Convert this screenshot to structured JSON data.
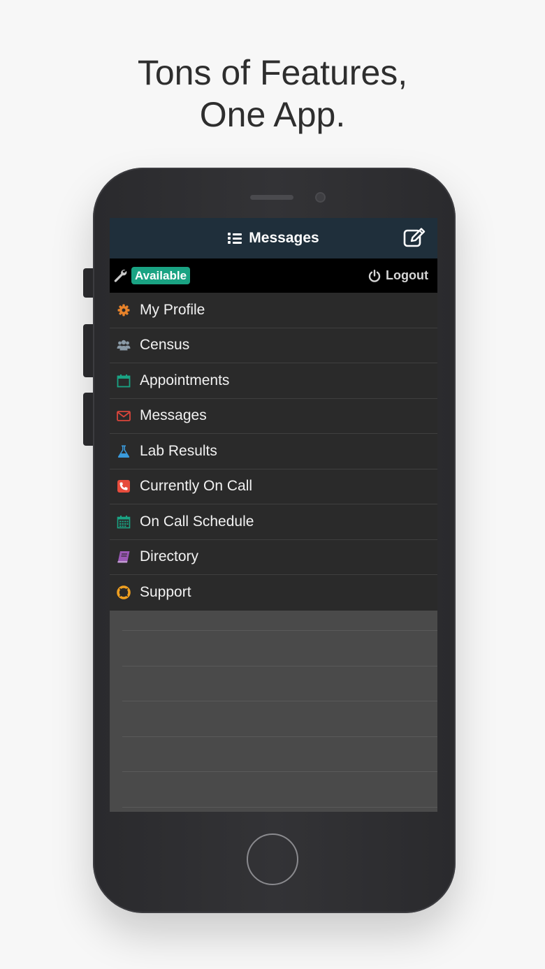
{
  "headline": {
    "line1": "Tons of Features,",
    "line2": "One App."
  },
  "topbar": {
    "title": "Messages",
    "title_icon": "list-icon",
    "action_icon": "compose-icon"
  },
  "status": {
    "tool_icon": "wrench-icon",
    "availability": "Available",
    "logout_label": "Logout",
    "logout_icon": "power-icon"
  },
  "menu": {
    "items": [
      {
        "label": "My Profile",
        "icon": "gear-icon",
        "color": "#e8832a"
      },
      {
        "label": "Census",
        "icon": "users-icon",
        "color": "#8a9aa6"
      },
      {
        "label": "Appointments",
        "icon": "calendar-icon",
        "color": "#1aa383"
      },
      {
        "label": "Messages",
        "icon": "envelope-icon",
        "color": "#d9453b"
      },
      {
        "label": "Lab Results",
        "icon": "flask-icon",
        "color": "#3a9bdc"
      },
      {
        "label": "Currently On Call",
        "icon": "phone-icon",
        "color": "#e74c3c"
      },
      {
        "label": "On Call Schedule",
        "icon": "calendar-grid-icon",
        "color": "#1aa383"
      },
      {
        "label": "Directory",
        "icon": "book-icon",
        "color": "#9b59b6"
      },
      {
        "label": "Support",
        "icon": "lifebuoy-icon",
        "color": "#f0a020"
      }
    ]
  },
  "colors": {
    "topbar": "#1f2f3b",
    "badge": "#1aa383"
  }
}
